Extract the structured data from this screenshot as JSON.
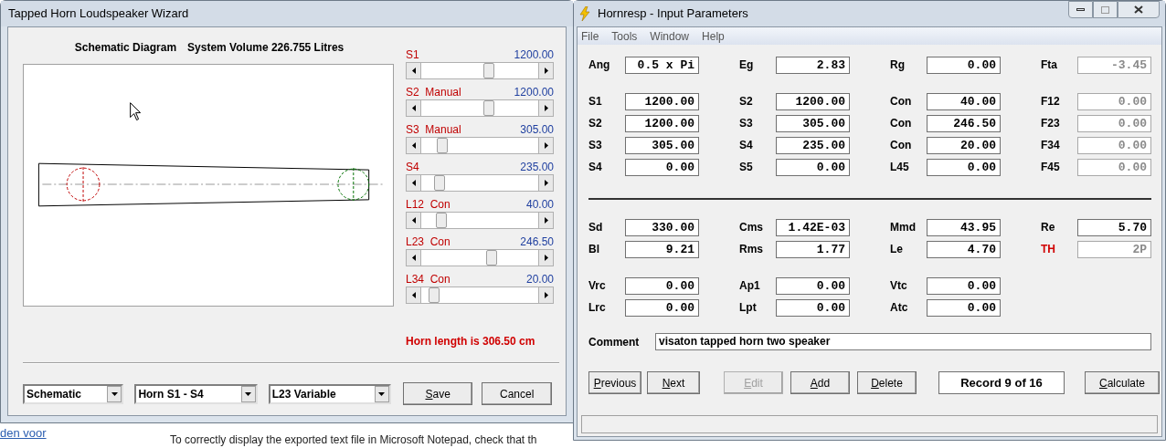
{
  "background": {
    "link": "den voor",
    "text": "To correctly display the exported text file in Microsoft Notepad, check that th"
  },
  "wizard": {
    "title": "Tapped Horn Loudspeaker Wizard",
    "heading": "Schematic Diagram",
    "volume": "System Volume 226.755 Litres",
    "sliders": [
      {
        "label": "S1",
        "value": "1200.00",
        "level": 0.59
      },
      {
        "label": "S2  Manual",
        "value": "1200.00",
        "level": 0.59
      },
      {
        "label": "S3  Manual",
        "value": "305.00",
        "level": 0.15
      },
      {
        "label": "S4",
        "value": "235.00",
        "level": 0.12
      },
      {
        "label": "L12  Con",
        "value": "40.00",
        "level": 0.14
      },
      {
        "label": "L23  Con",
        "value": "246.50",
        "level": 0.61
      },
      {
        "label": "L34  Con",
        "value": "20.00",
        "level": 0.07
      }
    ],
    "horn_length": "Horn length is 306.50 cm",
    "dropdowns": [
      {
        "value": "Schematic"
      },
      {
        "value": "Horn S1 - S4"
      },
      {
        "value": "L23 Variable"
      }
    ],
    "buttons": [
      {
        "label": "Save",
        "mnemonic": true
      },
      {
        "label": "Cancel",
        "mnemonic": false
      }
    ]
  },
  "hornresp": {
    "title": "Hornresp - Input Parameters",
    "menu": [
      "File",
      "Tools",
      "Window",
      "Help"
    ],
    "sections": [
      {
        "rows": [
          [
            {
              "label": "Ang",
              "value": "0.5 x Pi",
              "disabled": false,
              "highlighted": false
            },
            {
              "label": "Eg",
              "value": "2.83",
              "disabled": false,
              "highlighted": false
            },
            {
              "label": "Rg",
              "value": "0.00",
              "disabled": false,
              "highlighted": false
            },
            {
              "label": "Fta",
              "value": "-3.45",
              "disabled": true,
              "highlighted": false
            }
          ]
        ]
      },
      {
        "rows": [
          [
            {
              "label": "S1",
              "value": "1200.00",
              "disabled": false,
              "highlighted": false
            },
            {
              "label": "S2",
              "value": "1200.00",
              "disabled": false,
              "highlighted": false
            },
            {
              "label": "Con",
              "value": "40.00",
              "disabled": false,
              "highlighted": false
            },
            {
              "label": "F12",
              "value": "0.00",
              "disabled": true,
              "highlighted": false
            }
          ],
          [
            {
              "label": "S2",
              "value": "1200.00",
              "disabled": false,
              "highlighted": false
            },
            {
              "label": "S3",
              "value": "305.00",
              "disabled": false,
              "highlighted": false
            },
            {
              "label": "Con",
              "value": "246.50",
              "disabled": false,
              "highlighted": false
            },
            {
              "label": "F23",
              "value": "0.00",
              "disabled": true,
              "highlighted": false
            }
          ],
          [
            {
              "label": "S3",
              "value": "305.00",
              "disabled": false,
              "highlighted": false
            },
            {
              "label": "S4",
              "value": "235.00",
              "disabled": false,
              "highlighted": false
            },
            {
              "label": "Con",
              "value": "20.00",
              "disabled": false,
              "highlighted": false
            },
            {
              "label": "F34",
              "value": "0.00",
              "disabled": true,
              "highlighted": false
            }
          ],
          [
            {
              "label": "S4",
              "value": "0.00",
              "disabled": false,
              "highlighted": false
            },
            {
              "label": "S5",
              "value": "0.00",
              "disabled": false,
              "highlighted": false
            },
            {
              "label": "L45",
              "value": "0.00",
              "disabled": false,
              "highlighted": false
            },
            {
              "label": "F45",
              "value": "0.00",
              "disabled": true,
              "highlighted": false
            }
          ]
        ]
      },
      {
        "rows": [
          [
            {
              "label": "Sd",
              "value": "330.00",
              "disabled": false,
              "highlighted": false
            },
            {
              "label": "Cms",
              "value": "1.42E-03",
              "disabled": false,
              "highlighted": false
            },
            {
              "label": "Mmd",
              "value": "43.95",
              "disabled": false,
              "highlighted": false
            },
            {
              "label": "Re",
              "value": "5.70",
              "disabled": false,
              "highlighted": false
            }
          ],
          [
            {
              "label": "Bl",
              "value": "9.21",
              "disabled": false,
              "highlighted": false
            },
            {
              "label": "Rms",
              "value": "1.77",
              "disabled": false,
              "highlighted": false
            },
            {
              "label": "Le",
              "value": "4.70",
              "disabled": false,
              "highlighted": false
            },
            {
              "label": "TH",
              "value": "2P",
              "disabled": true,
              "highlighted": true
            }
          ]
        ]
      },
      {
        "rows": [
          [
            {
              "label": "Vrc",
              "value": "0.00",
              "disabled": false,
              "highlighted": false
            },
            {
              "label": "Ap1",
              "value": "0.00",
              "disabled": false,
              "highlighted": false
            },
            {
              "label": "Vtc",
              "value": "0.00",
              "disabled": false,
              "highlighted": false
            }
          ],
          [
            {
              "label": "Lrc",
              "value": "0.00",
              "disabled": false,
              "highlighted": false
            },
            {
              "label": "Lpt",
              "value": "0.00",
              "disabled": false,
              "highlighted": false
            },
            {
              "label": "Atc",
              "value": "0.00",
              "disabled": false,
              "highlighted": false
            }
          ]
        ]
      }
    ],
    "comment": {
      "label": "Comment",
      "value": "visaton tapped horn two speaker"
    },
    "buttons": [
      {
        "label": "Previous",
        "mnemonic": true,
        "disabled": false
      },
      {
        "label": "Next",
        "mnemonic": true,
        "disabled": false
      },
      {
        "label": "Edit",
        "mnemonic": true,
        "disabled": true
      },
      {
        "label": "Add",
        "mnemonic": true,
        "disabled": false
      },
      {
        "label": "Delete",
        "mnemonic": true,
        "disabled": false
      }
    ],
    "record": "Record 9 of 16",
    "calculate": {
      "label": "Calculate",
      "mnemonic": true,
      "disabled": false
    }
  }
}
